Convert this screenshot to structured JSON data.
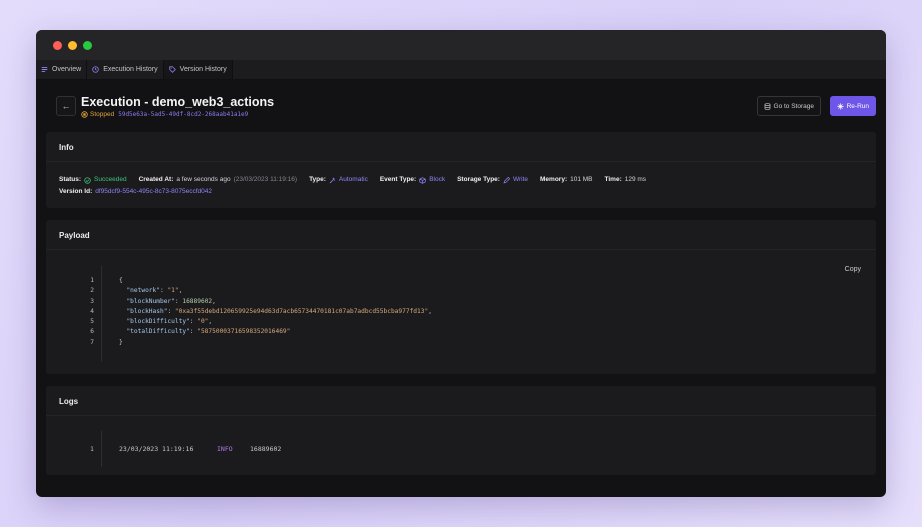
{
  "tabs": [
    {
      "label": "Overview",
      "icon": "list-icon"
    },
    {
      "label": "Execution History",
      "icon": "clock-icon"
    },
    {
      "label": "Version History",
      "icon": "tag-icon"
    }
  ],
  "header": {
    "title": "Execution - demo_web3_actions",
    "status": "Stopped",
    "execution_id": "59d5e63a-5ad5-49df-8cd2-268aab41a1e9",
    "go_to_storage_label": "Go to Storage",
    "rerun_label": "Re-Run"
  },
  "info": {
    "title": "Info",
    "status_label": "Status:",
    "status_value": "Succeeded",
    "created_label": "Created At:",
    "created_value": "a few seconds ago",
    "created_exact": "(23/03/2023 11:19:16)",
    "type_label": "Type:",
    "type_value": "Automatic",
    "event_type_label": "Event Type:",
    "event_type_value": "Block",
    "storage_type_label": "Storage Type:",
    "storage_type_value": "Write",
    "memory_label": "Memory:",
    "memory_value": "101 MB",
    "time_label": "Time:",
    "time_value": "129 ms",
    "version_label": "Version Id:",
    "version_value": "df95dcf9-554c-495c-8c73-8075eccfd042"
  },
  "payload": {
    "title": "Payload",
    "copy_label": "Copy",
    "lines": [
      {
        "n": "1",
        "text": "{"
      },
      {
        "n": "2",
        "key": "\"network\"",
        "value": "\"1\"",
        "vtype": "str",
        "trail": ","
      },
      {
        "n": "3",
        "key": "\"blockNumber\"",
        "value": "16889602",
        "vtype": "num",
        "trail": ","
      },
      {
        "n": "4",
        "key": "\"blockHash\"",
        "value": "\"0xa3f55debd120659925e94d63d7acb65734470181c07ab7adbcd55bcba977fd13\"",
        "vtype": "str",
        "trail": ","
      },
      {
        "n": "5",
        "key": "\"blockDifficulty\"",
        "value": "\"0\"",
        "vtype": "str",
        "trail": ","
      },
      {
        "n": "6",
        "key": "\"totalDifficulty\"",
        "value": "\"58750003716598352016469\"",
        "vtype": "str",
        "trail": ""
      },
      {
        "n": "7",
        "text": "}"
      }
    ]
  },
  "logs": {
    "title": "Logs",
    "entries": [
      {
        "n": "1",
        "time": "23/03/2023 11:19:16",
        "level": "INFO",
        "message": "16889602"
      }
    ]
  },
  "colors": {
    "accent": "#6d56e8",
    "success": "#3ec47c",
    "warning": "#e0a43a",
    "link": "#8f84f5"
  }
}
